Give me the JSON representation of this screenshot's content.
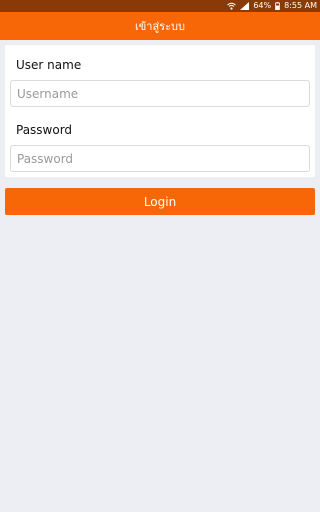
{
  "status_bar": {
    "battery": "64%",
    "time": "8:55 AM",
    "icons": [
      "wifi-icon",
      "signal-icon",
      "battery-icon"
    ]
  },
  "app_bar": {
    "title": "เข้าสู่ระบบ"
  },
  "form": {
    "username_label": "User name",
    "username_placeholder": "Username",
    "password_label": "Password",
    "password_placeholder": "Password"
  },
  "login_button": {
    "label": "Login"
  },
  "colors": {
    "accent": "#f76707",
    "status_bar": "#8a3a06",
    "background": "#eceef3"
  }
}
